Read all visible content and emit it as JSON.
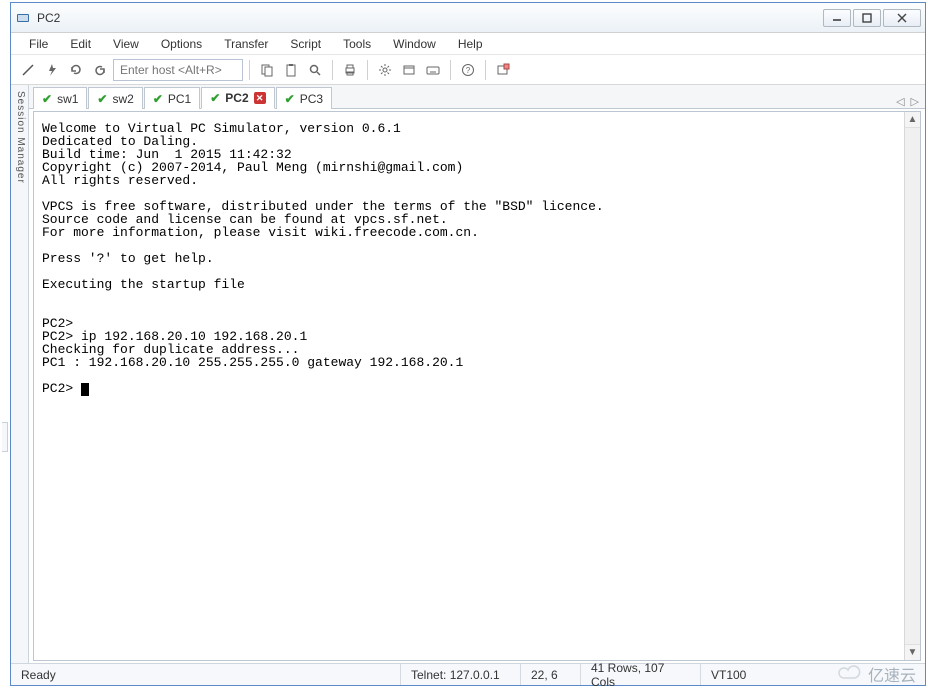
{
  "window": {
    "title": "PC2"
  },
  "menu": {
    "file": "File",
    "edit": "Edit",
    "view": "View",
    "options": "Options",
    "transfer": "Transfer",
    "script": "Script",
    "tools": "Tools",
    "window": "Window",
    "help": "Help"
  },
  "toolbar": {
    "host_placeholder": "Enter host <Alt+R>"
  },
  "session_manager_label": "Session Manager",
  "tabs": [
    {
      "label": "sw1",
      "active": false,
      "closeable": false
    },
    {
      "label": "sw2",
      "active": false,
      "closeable": false
    },
    {
      "label": "PC1",
      "active": false,
      "closeable": false
    },
    {
      "label": "PC2",
      "active": true,
      "closeable": true
    },
    {
      "label": "PC3",
      "active": false,
      "closeable": false
    }
  ],
  "terminal": {
    "lines": "Welcome to Virtual PC Simulator, version 0.6.1\nDedicated to Daling.\nBuild time: Jun  1 2015 11:42:32\nCopyright (c) 2007-2014, Paul Meng (mirnshi@gmail.com)\nAll rights reserved.\n\nVPCS is free software, distributed under the terms of the \"BSD\" licence.\nSource code and license can be found at vpcs.sf.net.\nFor more information, please visit wiki.freecode.com.cn.\n\nPress '?' to get help.\n\nExecuting the startup file\n\n\nPC2>\nPC2> ip 192.168.20.10 192.168.20.1\nChecking for duplicate address...\nPC1 : 192.168.20.10 255.255.255.0 gateway 192.168.20.1\n\nPC2> "
  },
  "status": {
    "ready": "Ready",
    "connection": "Telnet: 127.0.0.1",
    "cursor": "22,  6",
    "dims": "41 Rows, 107 Cols",
    "emulation": "VT100"
  },
  "watermark": "亿速云"
}
